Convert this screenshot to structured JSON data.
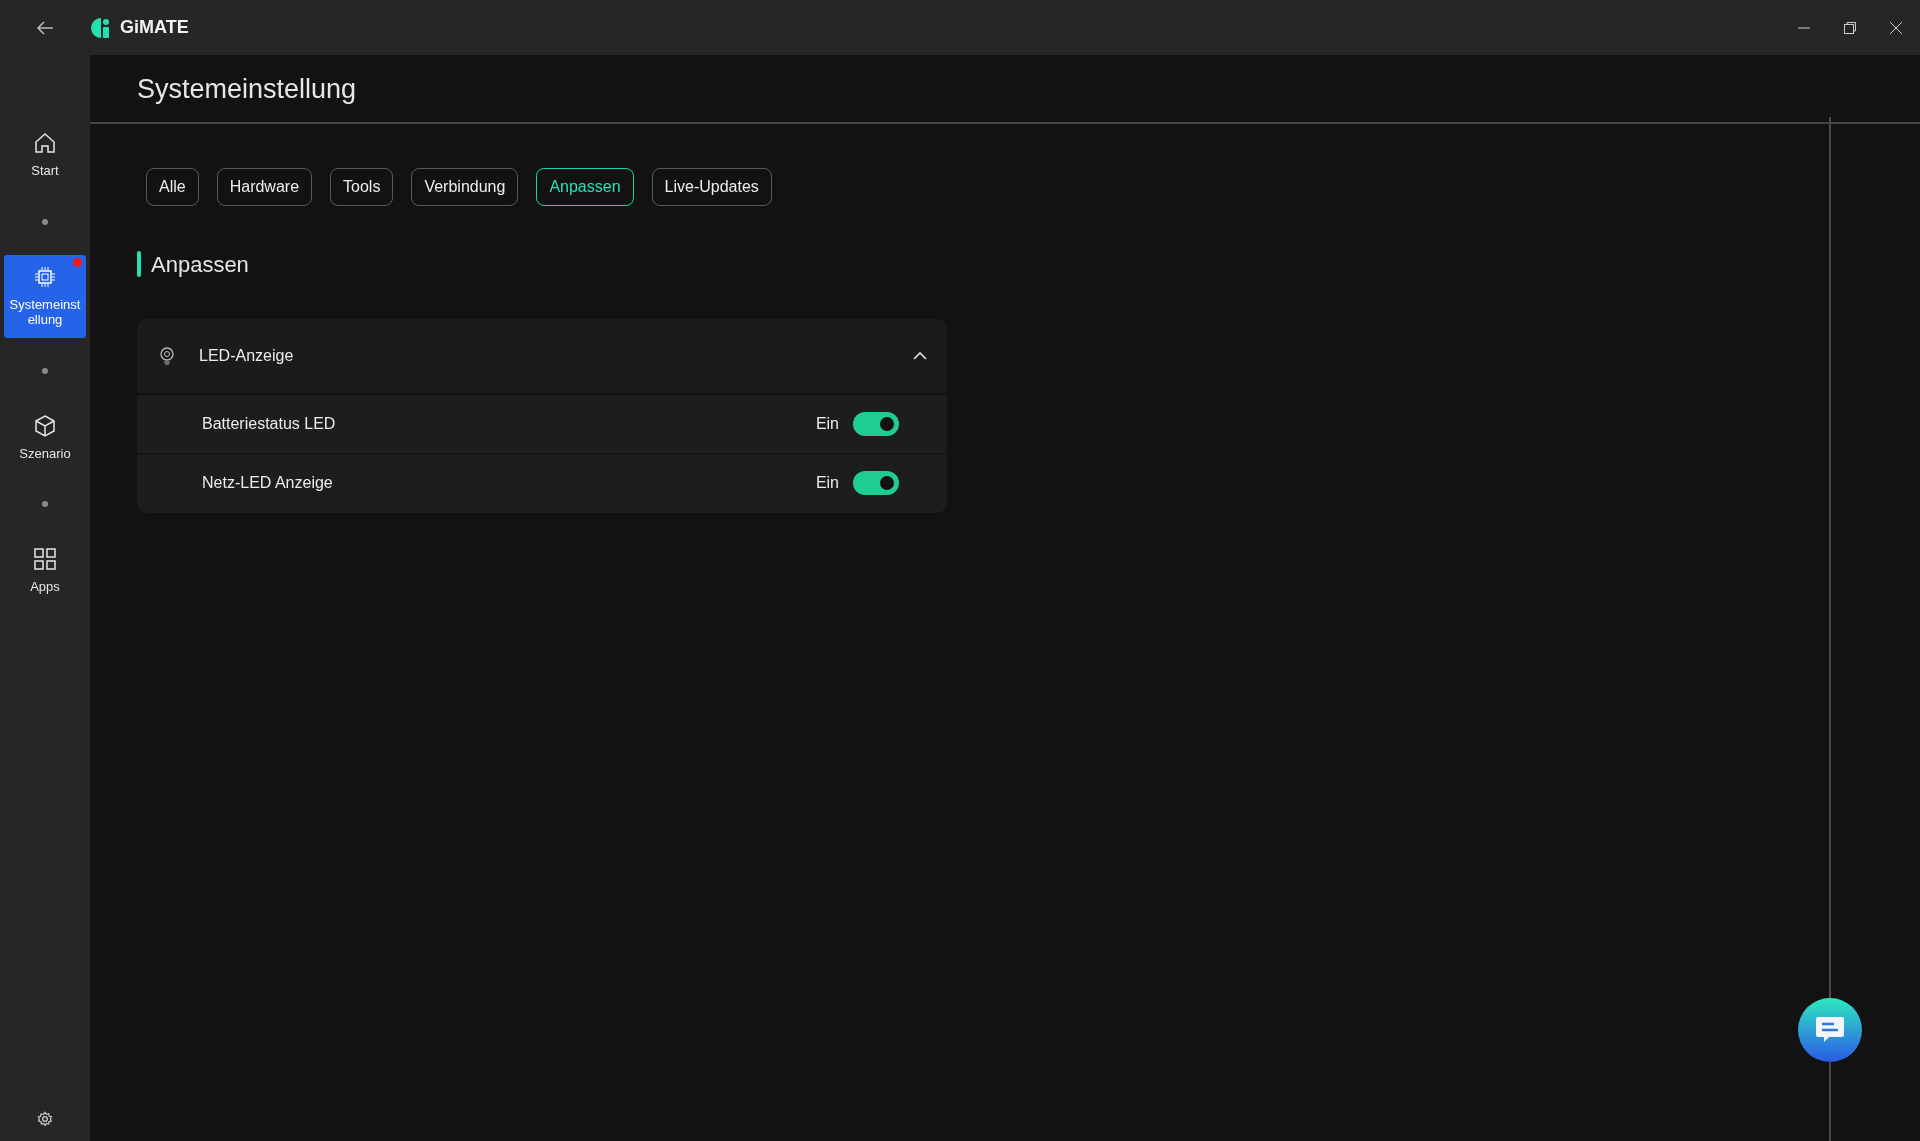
{
  "app": {
    "title": "GiMATE"
  },
  "sidebar": {
    "items": [
      {
        "kind": "home",
        "label": "Start",
        "selected": false,
        "notification": false
      },
      {
        "kind": "chip",
        "label": "Systemeinstellung",
        "selected": true,
        "notification": true
      },
      {
        "kind": "cube",
        "label": "Szenario",
        "selected": false,
        "notification": false
      },
      {
        "kind": "apps",
        "label": "Apps",
        "selected": false,
        "notification": false
      }
    ]
  },
  "page_title": "Systemeinstellung",
  "tabs": [
    {
      "label": "Alle",
      "selected": false
    },
    {
      "label": "Hardware",
      "selected": false
    },
    {
      "label": "Tools",
      "selected": false
    },
    {
      "label": "Verbindung",
      "selected": false
    },
    {
      "label": "Anpassen",
      "selected": true
    },
    {
      "label": "Live-Updates",
      "selected": false
    }
  ],
  "section": {
    "title": "Anpassen",
    "group": {
      "title": "LED-Anzeige",
      "expanded": true,
      "items": [
        {
          "label": "Batteriestatus LED",
          "state_label": "Ein",
          "on": true
        },
        {
          "label": "Netz-LED Anzeige",
          "state_label": "Ein",
          "on": true
        }
      ]
    }
  }
}
